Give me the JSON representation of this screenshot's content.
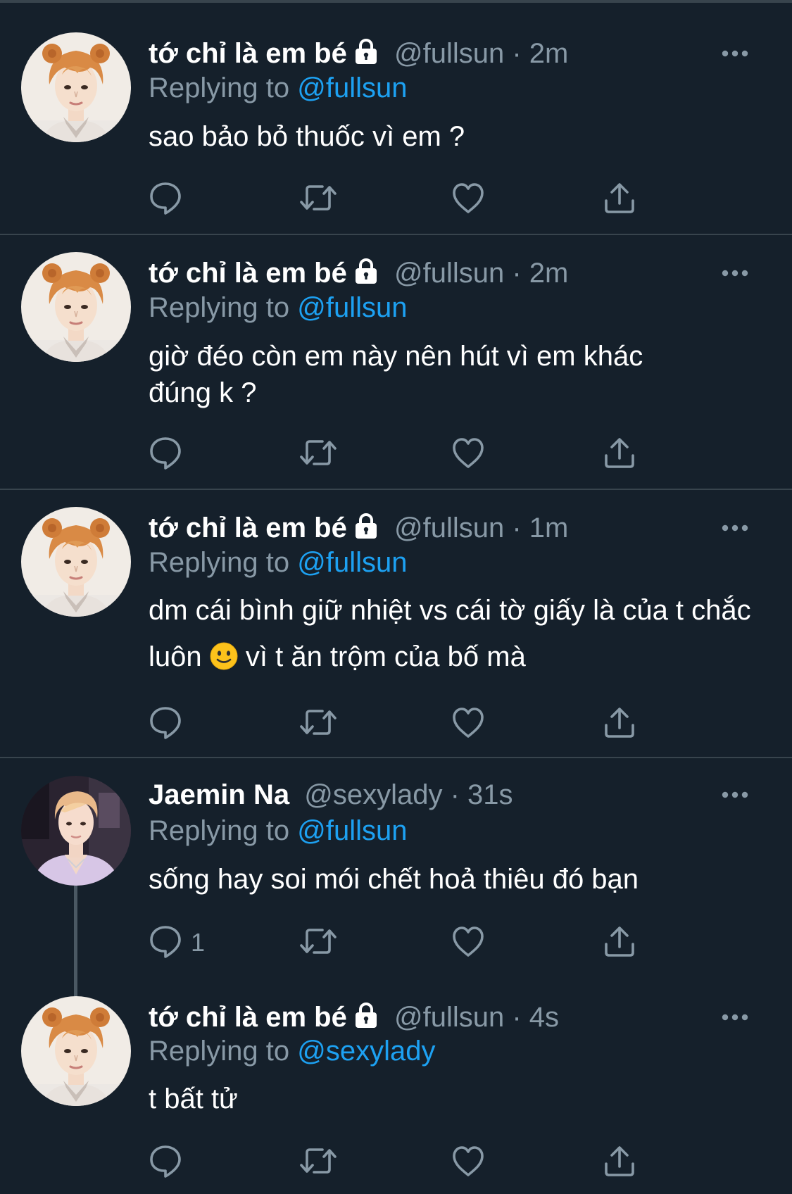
{
  "colors": {
    "background": "#15202b",
    "divider": "#38444d",
    "text_primary": "#ffffff",
    "text_secondary": "#8899a6",
    "accent": "#1da1f2"
  },
  "tweets": [
    {
      "name": "tớ chỉ là em bé",
      "protected": true,
      "handle": "@fullsun",
      "dot": "·",
      "time": "2m",
      "replying_prefix": "Replying to",
      "replying_to": "@fullsun",
      "text": "sao bảo bỏ thuốc vì em ?",
      "reply_count": ""
    },
    {
      "name": "tớ chỉ là em bé",
      "protected": true,
      "handle": "@fullsun",
      "dot": "·",
      "time": "2m",
      "replying_prefix": "Replying to",
      "replying_to": "@fullsun",
      "text": "giờ đéo còn em này nên hút vì em khác đúng k ?",
      "reply_count": ""
    },
    {
      "name": "tớ chỉ là em bé",
      "protected": true,
      "handle": "@fullsun",
      "dot": "·",
      "time": "1m",
      "replying_prefix": "Replying to",
      "replying_to": "@fullsun",
      "text_before_emoji": "dm cái bình giữ nhiệt vs cái tờ giấy là của t chắc luôn",
      "emoji": "slightly-smiling-face",
      "text_after_emoji": "vì t ăn trộm của bố mà",
      "reply_count": ""
    },
    {
      "name": "Jaemin Na",
      "protected": false,
      "handle": "@sexylady",
      "dot": "·",
      "time": "31s",
      "replying_prefix": "Replying to",
      "replying_to": "@fullsun",
      "text": "sống hay soi mói chết hoả thiêu đó bạn",
      "reply_count": "1"
    },
    {
      "name": "tớ chỉ là em bé",
      "protected": true,
      "handle": "@fullsun",
      "dot": "·",
      "time": "4s",
      "replying_prefix": "Replying to",
      "replying_to": "@sexylady",
      "text": "t bất tử",
      "reply_count": ""
    }
  ]
}
